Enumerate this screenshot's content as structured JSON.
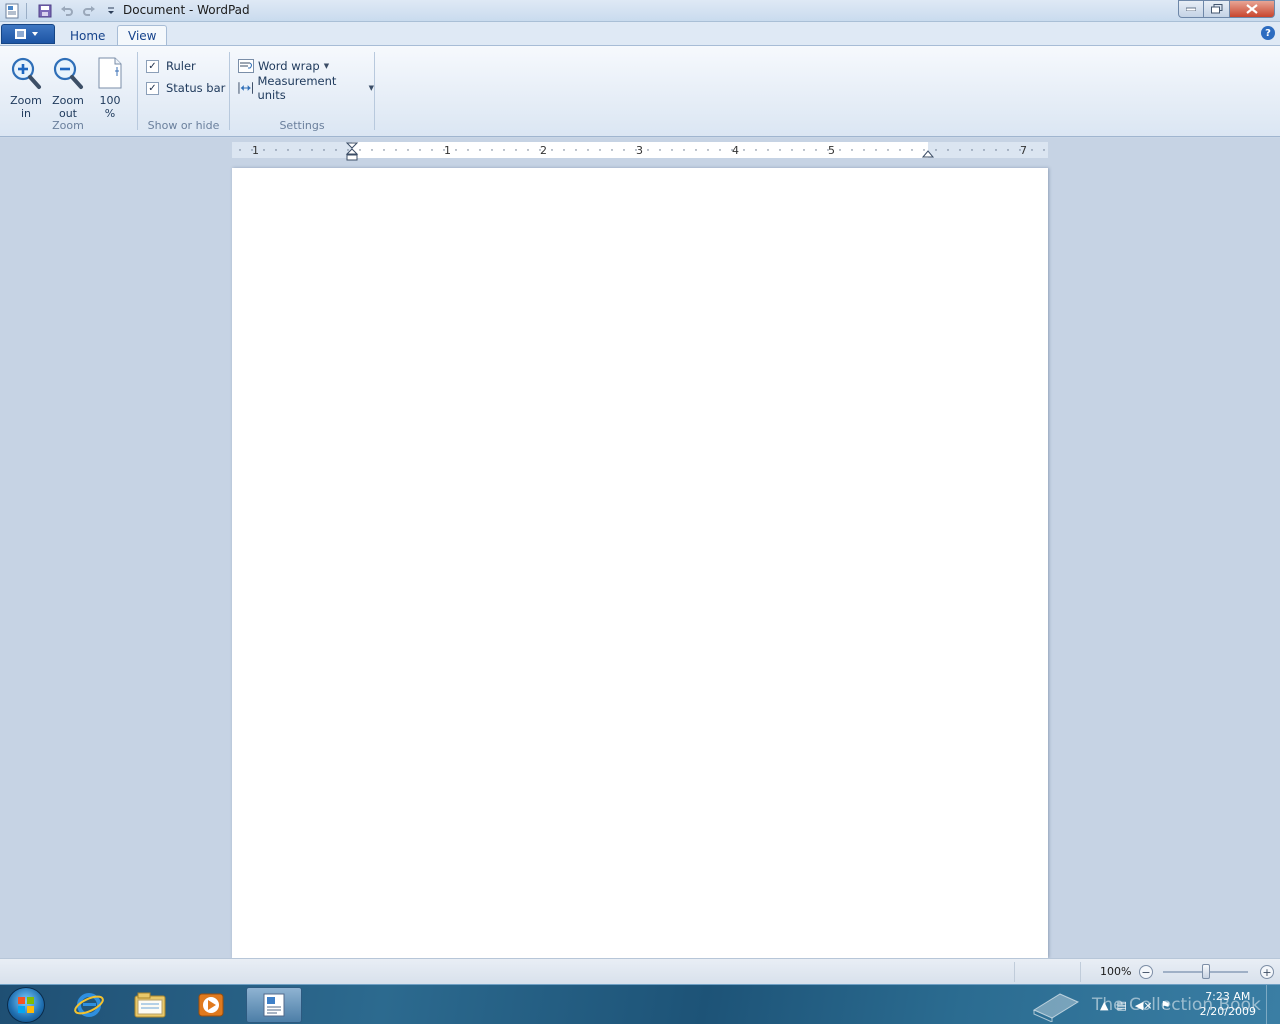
{
  "window": {
    "title": "Document - WordPad"
  },
  "tabs": {
    "home": "Home",
    "view": "View"
  },
  "ribbon": {
    "zoom_group": {
      "label": "Zoom",
      "zoom_in_line1": "Zoom",
      "zoom_in_line2": "in",
      "zoom_out_line1": "Zoom",
      "zoom_out_line2": "out",
      "hundred_line1": "100",
      "hundred_line2": "%"
    },
    "show_hide_group": {
      "label": "Show or hide",
      "ruler": "Ruler",
      "ruler_checked": true,
      "status_bar": "Status bar",
      "status_bar_checked": true
    },
    "settings_group": {
      "label": "Settings",
      "word_wrap": "Word wrap",
      "measurement_units": "Measurement units"
    }
  },
  "ruler": {
    "numbers": [
      "1",
      "1",
      "2",
      "3",
      "4",
      "5",
      "7"
    ]
  },
  "statusbar": {
    "zoom_percent": "100%",
    "zoom_level": 1.0
  },
  "taskbar": {
    "icons": [
      "start-orb",
      "internet-explorer-icon",
      "windows-explorer-icon",
      "media-player-icon",
      "wordpad-icon"
    ],
    "watermark": "The Collection Book",
    "time": "7:23 AM",
    "date": "2/20/2009"
  },
  "colors": {
    "ribbon_tab_text": "#15428b",
    "workspace": "#c6d3e4",
    "taskbar": "#2c6a8f"
  }
}
